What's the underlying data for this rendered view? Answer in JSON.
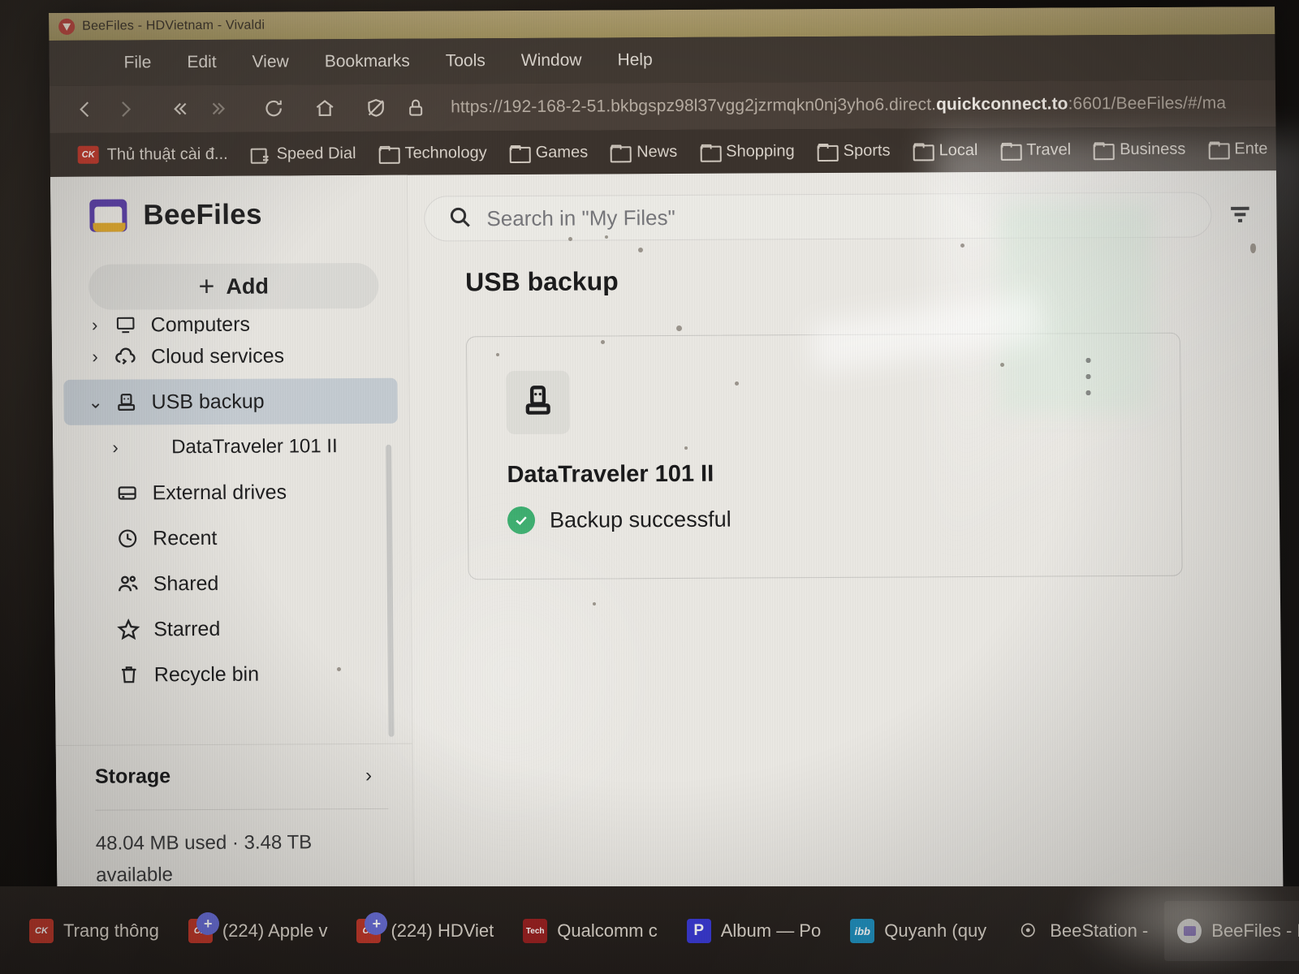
{
  "browser": {
    "window_title": "BeeFiles - HDVietnam - Vivaldi",
    "menus": [
      "File",
      "Edit",
      "View",
      "Bookmarks",
      "Tools",
      "Window",
      "Help"
    ],
    "url": {
      "prefix": "https://192-168-2-51.bkbgspz98l37vgg2jzrmqkn0nj3yho6.direct.",
      "host_bold": "quickconnect.to",
      "suffix": ":6601/BeeFiles/#/ma"
    },
    "toolbar_icons": [
      "back-icon",
      "forward-icon",
      "rewind-icon",
      "fast-forward-icon",
      "reload-icon",
      "home-icon",
      "shield-off-icon",
      "lock-icon"
    ],
    "bookmarks": [
      {
        "label": "Thủ thuật cài đ...",
        "icon": "ck-site-icon"
      },
      {
        "label": "Speed Dial",
        "icon": "speed-dial-icon"
      },
      {
        "label": "Technology",
        "icon": "folder-icon"
      },
      {
        "label": "Games",
        "icon": "folder-icon"
      },
      {
        "label": "News",
        "icon": "folder-icon"
      },
      {
        "label": "Shopping",
        "icon": "folder-icon"
      },
      {
        "label": "Sports",
        "icon": "folder-icon"
      },
      {
        "label": "Local",
        "icon": "folder-icon"
      },
      {
        "label": "Travel",
        "icon": "folder-icon"
      },
      {
        "label": "Business",
        "icon": "folder-icon"
      },
      {
        "label": "Ente",
        "icon": "folder-icon"
      }
    ]
  },
  "app": {
    "brand": "BeeFiles",
    "add_button": "Add",
    "search": {
      "placeholder": "Search in \"My Files\""
    },
    "filter_icon": "filter-icon",
    "page_title": "USB backup",
    "sidebar": {
      "clipped_top_item": "Computers",
      "items": [
        {
          "label": "Cloud services",
          "icon": "cloud-sync-icon",
          "chevron": "›",
          "selected": false,
          "sub": false
        },
        {
          "label": "USB backup",
          "icon": "usb-icon",
          "chevron": "⌄",
          "selected": true,
          "sub": false
        },
        {
          "label": "DataTraveler 101 II",
          "icon": "",
          "chevron": "›",
          "selected": false,
          "sub": true
        },
        {
          "label": "External drives",
          "icon": "hdd-icon",
          "chevron": "",
          "selected": false,
          "sub": false
        },
        {
          "label": "Recent",
          "icon": "clock-icon",
          "chevron": "",
          "selected": false,
          "sub": false
        },
        {
          "label": "Shared",
          "icon": "people-icon",
          "chevron": "",
          "selected": false,
          "sub": false
        },
        {
          "label": "Starred",
          "icon": "star-icon",
          "chevron": "",
          "selected": false,
          "sub": false
        },
        {
          "label": "Recycle bin",
          "icon": "trash-icon",
          "chevron": "",
          "selected": false,
          "sub": false
        }
      ],
      "storage": {
        "title": "Storage",
        "chevron": "›",
        "usage_text": "48.04 MB used  ·  3.48 TB available"
      }
    },
    "device_card": {
      "icon": "usb-stick-icon",
      "name": "DataTraveler 101 II",
      "status": "Backup successful",
      "status_icon": "check-circle-icon",
      "status_color": "#3cae6f"
    }
  },
  "taskbar": {
    "items": [
      {
        "label": "Trang thông",
        "icon": "ck-icon",
        "badge": "",
        "active": false
      },
      {
        "label": "(224) Apple v",
        "icon": "ck-icon",
        "badge": "+",
        "active": false
      },
      {
        "label": "(224) HDViet",
        "icon": "ck-icon",
        "badge": "+",
        "active": false
      },
      {
        "label": "Qualcomm c",
        "icon": "tech-icon",
        "badge": "",
        "active": false
      },
      {
        "label": "Album — Po",
        "icon": "p-icon",
        "badge": "",
        "active": false
      },
      {
        "label": "Quyanh (quy",
        "icon": "ibb-icon",
        "badge": "",
        "active": false
      },
      {
        "label": "BeeStation -",
        "icon": "beestation-icon",
        "badge": "",
        "active": false
      },
      {
        "label": "BeeFiles - H",
        "icon": "beefiles-icon",
        "badge": "",
        "active": true
      }
    ]
  }
}
